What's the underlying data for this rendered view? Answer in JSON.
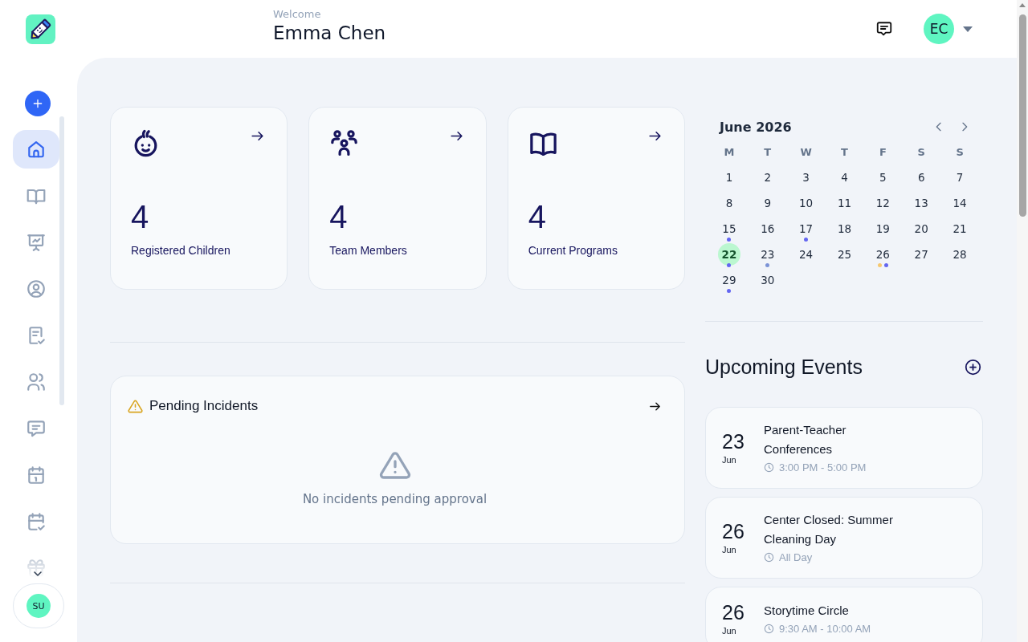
{
  "sidebar": {
    "items": [
      {
        "selected": true
      },
      {
        "selected": false
      },
      {
        "selected": false
      },
      {
        "selected": false
      },
      {
        "selected": false
      },
      {
        "selected": false
      },
      {
        "selected": false
      },
      {
        "selected": false
      },
      {
        "selected": false
      },
      {
        "selected": false
      }
    ],
    "user_initials": "SU"
  },
  "header": {
    "greeting": "Welcome",
    "user_name": "Emma Chen",
    "avatar_initials": "EC"
  },
  "stats": [
    {
      "value": "4",
      "label": "Registered Children"
    },
    {
      "value": "4",
      "label": "Team Members"
    },
    {
      "value": "4",
      "label": "Current Programs"
    }
  ],
  "pending_incidents": {
    "title": "Pending Incidents",
    "empty_message": "No incidents pending approval"
  },
  "calendar": {
    "title": "June 2026",
    "weekdays": [
      "M",
      "T",
      "W",
      "T",
      "F",
      "S",
      "S"
    ],
    "days": [
      {
        "label": "1",
        "today": false
      },
      {
        "label": "2",
        "today": false
      },
      {
        "label": "3",
        "today": false
      },
      {
        "label": "4",
        "today": false
      },
      {
        "label": "5",
        "today": false
      },
      {
        "label": "6",
        "today": false
      },
      {
        "label": "7",
        "today": false
      },
      {
        "label": "8",
        "today": false
      },
      {
        "label": "9",
        "today": false
      },
      {
        "label": "10",
        "today": false
      },
      {
        "label": "11",
        "today": false
      },
      {
        "label": "12",
        "today": false
      },
      {
        "label": "13",
        "today": false
      },
      {
        "label": "14",
        "today": false
      },
      {
        "label": "15",
        "today": false,
        "dots": [
          {
            "color": "#6366f1"
          }
        ]
      },
      {
        "label": "16",
        "today": false
      },
      {
        "label": "17",
        "today": false,
        "dots": [
          {
            "color": "#6366f1"
          }
        ]
      },
      {
        "label": "18",
        "today": false
      },
      {
        "label": "19",
        "today": false
      },
      {
        "label": "20",
        "today": false
      },
      {
        "label": "21",
        "today": false
      },
      {
        "label": "22",
        "today": true,
        "dots": [
          {
            "color": "#6366f1"
          }
        ]
      },
      {
        "label": "23",
        "today": false,
        "dots": [
          {
            "color": "#7b93d6"
          }
        ]
      },
      {
        "label": "24",
        "today": false
      },
      {
        "label": "25",
        "today": false
      },
      {
        "label": "26",
        "today": false,
        "dots": [
          {
            "color": "#f6c870"
          },
          {
            "color": "#6366f1"
          }
        ]
      },
      {
        "label": "27",
        "today": false
      },
      {
        "label": "28",
        "today": false
      },
      {
        "label": "29",
        "today": false,
        "dots": [
          {
            "color": "#6366f1"
          }
        ]
      },
      {
        "label": "30",
        "today": false
      }
    ]
  },
  "upcoming_events": {
    "title": "Upcoming Events",
    "events": [
      {
        "day": "23",
        "month": "Jun",
        "title": "Parent-Teacher Conferences",
        "time": "3:00 PM - 5:00 PM"
      },
      {
        "day": "26",
        "month": "Jun",
        "title": "Center Closed: Summer Cleaning Day",
        "time": "All Day"
      },
      {
        "day": "26",
        "month": "Jun",
        "title": "Storytime Circle",
        "time": "9:30 AM - 10:00 AM"
      }
    ]
  }
}
